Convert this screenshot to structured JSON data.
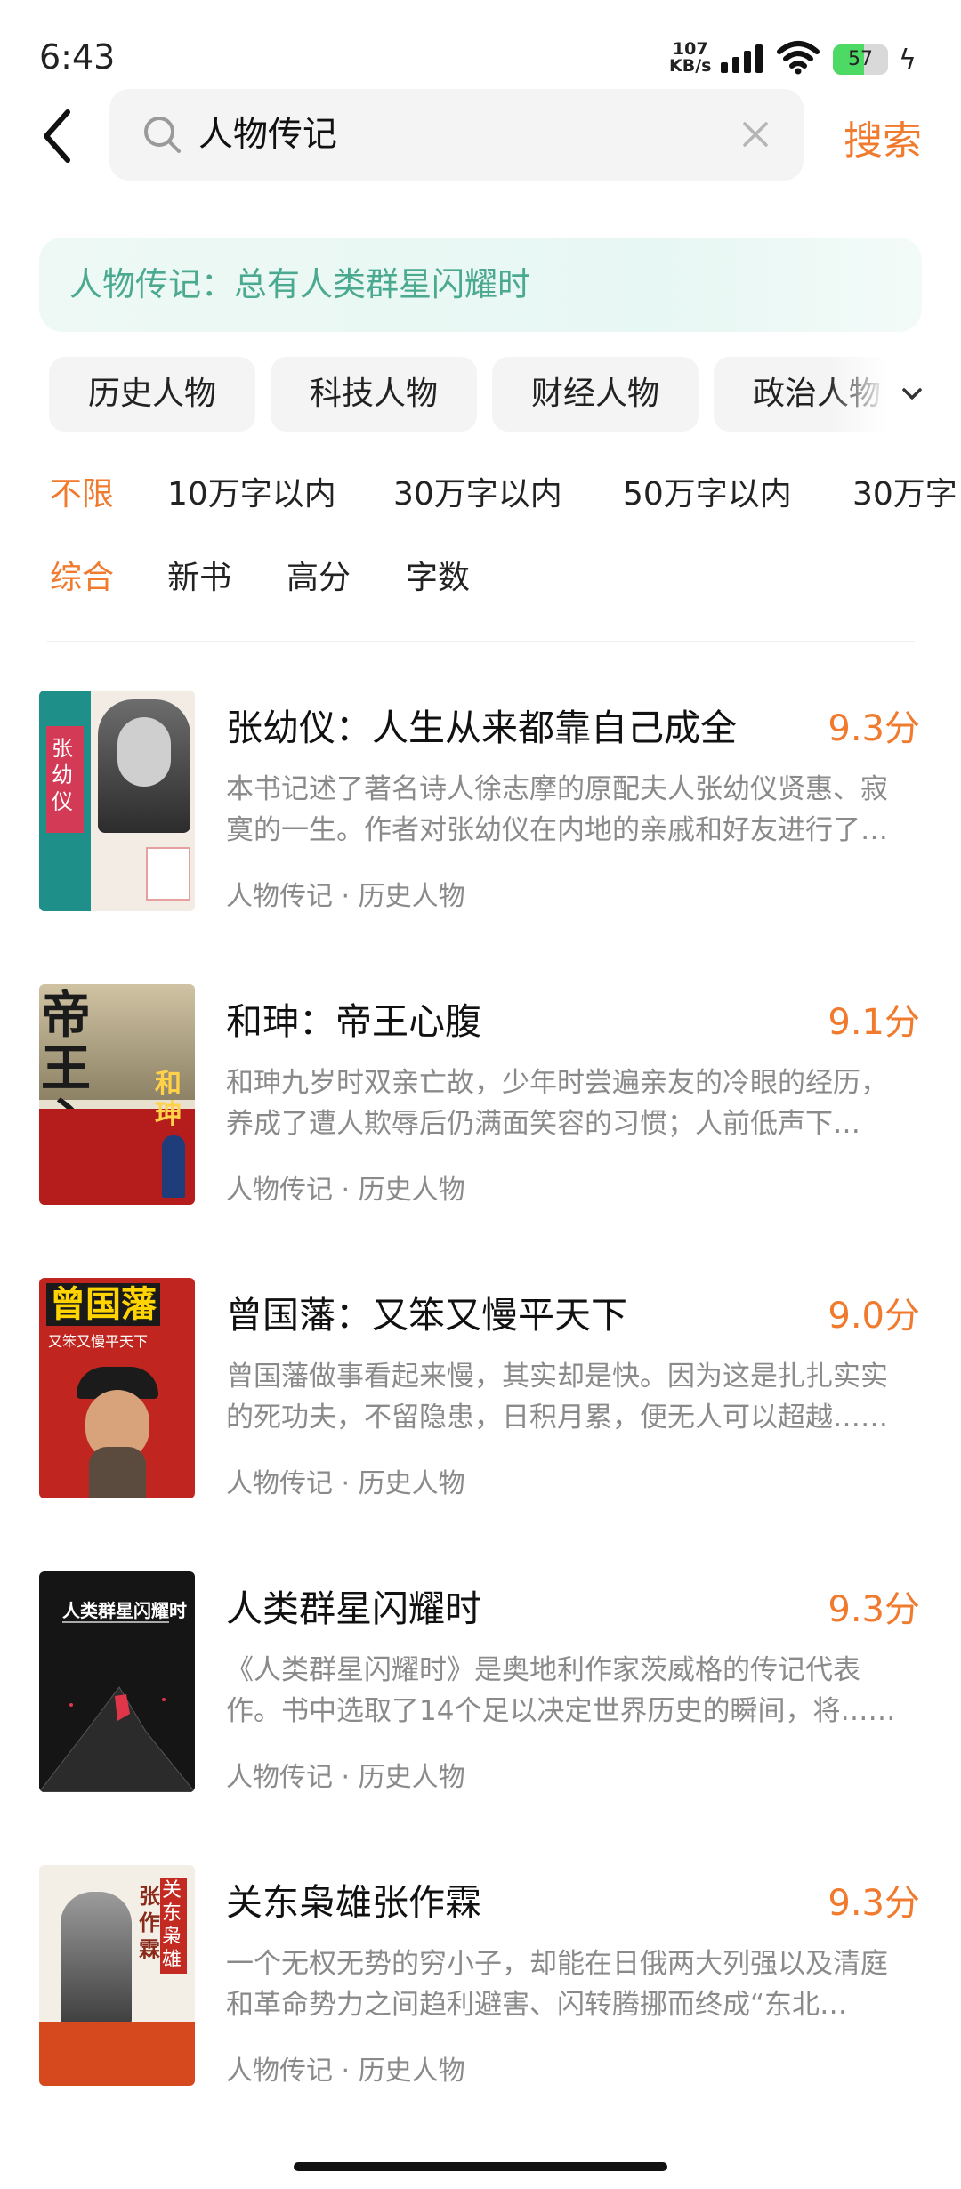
{
  "status": {
    "time": "6:43",
    "net_speed": "107",
    "net_unit": "KB/s",
    "battery": "57",
    "battery_level": 0.57
  },
  "search": {
    "query": "人物传记",
    "button": "搜索"
  },
  "banner": {
    "text": "人物传记：总有人类群星闪耀时"
  },
  "categories": [
    "历史人物",
    "科技人物",
    "财经人物",
    "政治人物"
  ],
  "word_filters": [
    "不限",
    "10万字以内",
    "30万字以内",
    "50万字以内",
    "30万字"
  ],
  "sort_options": [
    "综合",
    "新书",
    "高分",
    "字数"
  ],
  "books": [
    {
      "title": "张幼仪：人生从来都靠自己成全",
      "score": "9.3分",
      "desc": "本书记述了著名诗人徐志摩的原配夫人张幼仪贤惠、寂寞的一生。作者对张幼仪在内地的亲戚和好友进行了采访……",
      "tags": "人物传记 · 历史人物",
      "cover_text": "张幼仪",
      "cover_color": "#1f8f8a"
    },
    {
      "title": "和珅：帝王心腹",
      "score": "9.1分",
      "desc": "和珅九岁时双亲亡故，少年时尝遍亲友的冷眼的经历，养成了遭人欺辱后仍满面笑容的习惯；人前低声下气……",
      "tags": "人物传记 · 历史人物",
      "cover_text": "帝王心腹",
      "cover_sub": "和珅",
      "cover_color": "#b51d1d"
    },
    {
      "title": "曾国藩：又笨又慢平天下",
      "score": "9.0分",
      "desc": "曾国藩做事看起来慢，其实却是快。因为这是扎扎实实的死功夫，不留隐患，日积月累，便无人可以超越……",
      "tags": "人物传记 · 历史人物",
      "cover_text": "曾国藩",
      "cover_sub": "又笨又慢平天下",
      "cover_color": "#c0261f"
    },
    {
      "title": "人类群星闪耀时",
      "score": "9.3分",
      "desc": "《人类群星闪耀时》是奥地利作家茨威格的传记代表作。书中选取了14个足以决定世界历史的瞬间，将……",
      "tags": "人物传记 · 历史人物",
      "cover_text": "人类群星闪耀时",
      "cover_color": "#151515"
    },
    {
      "title": "关东枭雄张作霖",
      "score": "9.3分",
      "desc": "一个无权无势的穷小子，却能在日俄两大列强以及清庭和革命势力之间趋利避害、闪转腾挪而终成“东北王”……",
      "tags": "人物传记 · 历史人物",
      "cover_text": "张作霖",
      "cover_sub": "关东枭雄",
      "cover_color": "#d6491f"
    }
  ]
}
